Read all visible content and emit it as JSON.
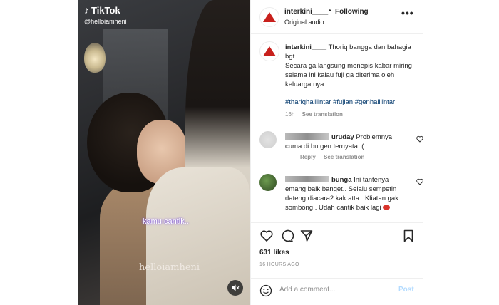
{
  "video": {
    "tiktok_brand": "TikTok",
    "tiktok_handle": "@helloiamheni",
    "overlay_caption": "kamu cantik..",
    "watermark": "helloiamheni"
  },
  "header": {
    "username": "interkini____",
    "separator": "•",
    "follow_label": "Following",
    "audio_label": "Original audio",
    "more_label": "•••"
  },
  "post": {
    "username": "interkini____",
    "caption_lines": [
      "Thoriq bangga dan bahagia bgt...",
      "Secara ga langsung menepis kabar miring selama ini kalau fuji ga diterima oleh keluarga nya..."
    ],
    "hashtags": "#thariqhalilintar #fujian #genhalilintar",
    "age": "16h",
    "see_translation": "See translation"
  },
  "comments": [
    {
      "name_visible": "uruday",
      "text": "Problemnya cuma di bu gen ternyata :(",
      "reply_label": "Reply",
      "see_translation": "See translation"
    },
    {
      "name_visible": "bunga",
      "text": "Ini tantenya emang baik banget.. Selalu sempetin dateng diacara2 kak atta.. Kliatan gak sombong.. Udah cantik baik lagi"
    }
  ],
  "actions": {
    "likes": "631 likes",
    "timestamp": "16 HOURS AGO"
  },
  "composer": {
    "placeholder": "Add a comment...",
    "post_label": "Post"
  },
  "colors": {
    "brand_red": "#c8201c",
    "link_blue": "#00376b",
    "post_disabled": "#b3dbff",
    "muted": "#8e8e8e"
  }
}
